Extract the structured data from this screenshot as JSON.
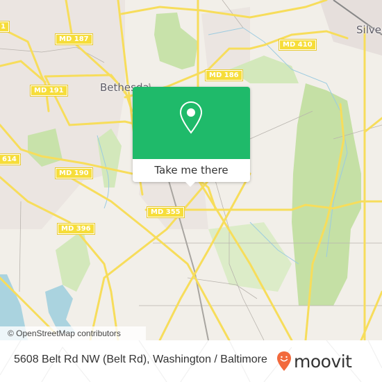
{
  "map": {
    "attribution": "© OpenStreetMap contributors",
    "city_labels": [
      {
        "id": "bethesda",
        "text": "Bethesda"
      },
      {
        "id": "silver-spring",
        "text": "Silve"
      }
    ],
    "route_shields": [
      {
        "id": "md-187",
        "text": "MD 187"
      },
      {
        "id": "md-191",
        "text": "MD 191"
      },
      {
        "id": "md-186",
        "text": "MD 186"
      },
      {
        "id": "md-410",
        "text": "MD 410"
      },
      {
        "id": "md-190",
        "text": "MD 190"
      },
      {
        "id": "md-614",
        "text": "614"
      },
      {
        "id": "md-355",
        "text": "MD 355"
      },
      {
        "id": "md-396",
        "text": "MD 396"
      },
      {
        "id": "md-edge",
        "text": "1"
      }
    ],
    "colors": {
      "land": "#f2efe9",
      "residential": "#e9e2de",
      "park": "#c5e0a5",
      "water": "#aad3df",
      "road_major": "#f7dd5b",
      "road_minor": "#b8b3ad"
    }
  },
  "popup": {
    "icon": "map-pin-icon",
    "button_label": "Take me there",
    "accent_color": "#1fba6a"
  },
  "footer": {
    "address": "5608 Belt Rd NW (Belt Rd), Washington / Baltimore",
    "brand": "moovit",
    "brand_icon": "moovit-smile-pin-icon",
    "brand_color": "#f26a3d"
  }
}
